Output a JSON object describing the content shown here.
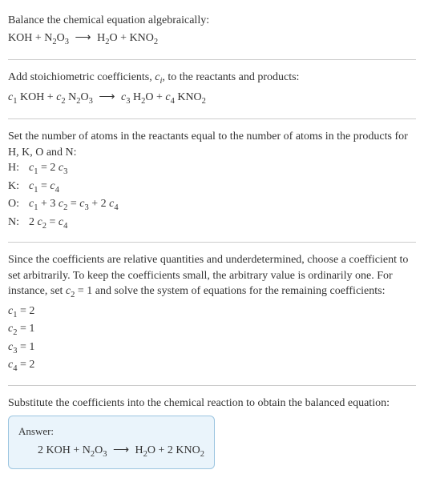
{
  "section1": {
    "intro": "Balance the chemical equation algebraically:",
    "eq_lhs1": "KOH",
    "eq_plus1": " + ",
    "eq_lhs2": "N",
    "eq_lhs2_sub": "2",
    "eq_lhs3": "O",
    "eq_lhs3_sub": "3",
    "eq_arrow": "⟶",
    "eq_rhs1": "H",
    "eq_rhs1_sub": "2",
    "eq_rhs2": "O",
    "eq_plus2": " + ",
    "eq_rhs3": "KNO",
    "eq_rhs3_sub": "2"
  },
  "section2": {
    "intro_a": "Add stoichiometric coefficients, ",
    "intro_var": "c",
    "intro_sub": "i",
    "intro_b": ", to the reactants and products:",
    "c1": "c",
    "c1s": "1",
    "t1": " KOH + ",
    "c2": "c",
    "c2s": "2",
    "t2a": " N",
    "t2a_sub": "2",
    "t2b": "O",
    "t2b_sub": "3",
    "arrow": "⟶",
    "c3": "c",
    "c3s": "3",
    "t3a": " H",
    "t3a_sub": "2",
    "t3b": "O + ",
    "c4": "c",
    "c4s": "4",
    "t4": " KNO",
    "t4_sub": "2"
  },
  "section3": {
    "intro": "Set the number of atoms in the reactants equal to the number of atoms in the products for H, K, O and N:",
    "rows": [
      {
        "el": "H:",
        "lhs_c": "c",
        "lhs_s": "1",
        "eq": " = 2 ",
        "rhs_c": "c",
        "rhs_s": "3",
        "tail": ""
      },
      {
        "el": "K:",
        "lhs_c": "c",
        "lhs_s": "1",
        "eq": " = ",
        "rhs_c": "c",
        "rhs_s": "4",
        "tail": ""
      },
      {
        "el": "O:",
        "lhs_c": "c",
        "lhs_s": "1",
        "eq": " + 3 ",
        "rhs_c": "c",
        "rhs_s": "2",
        "tail_a": " = ",
        "tail_c1": "c",
        "tail_s1": "3",
        "tail_b": " + 2 ",
        "tail_c2": "c",
        "tail_s2": "4"
      },
      {
        "el": "N:",
        "lhs_pre": "2 ",
        "lhs_c": "c",
        "lhs_s": "2",
        "eq": " = ",
        "rhs_c": "c",
        "rhs_s": "4",
        "tail": ""
      }
    ]
  },
  "section4": {
    "intro_a": "Since the coefficients are relative quantities and underdetermined, choose a coefficient to set arbitrarily. To keep the coefficients small, the arbitrary value is ordinarily one. For instance, set ",
    "intro_var": "c",
    "intro_sub": "2",
    "intro_b": " = 1 and solve the system of equations for the remaining coefficients:",
    "coeffs": [
      {
        "c": "c",
        "s": "1",
        "v": " = 2"
      },
      {
        "c": "c",
        "s": "2",
        "v": " = 1"
      },
      {
        "c": "c",
        "s": "3",
        "v": " = 1"
      },
      {
        "c": "c",
        "s": "4",
        "v": " = 2"
      }
    ]
  },
  "section5": {
    "intro": "Substitute the coefficients into the chemical reaction to obtain the balanced equation:",
    "answer_label": "Answer:",
    "eq_a": "2 KOH + N",
    "eq_a_sub": "2",
    "eq_b": "O",
    "eq_b_sub": "3",
    "arrow": "⟶",
    "eq_c": "H",
    "eq_c_sub": "2",
    "eq_d": "O + 2 KNO",
    "eq_d_sub": "2"
  }
}
